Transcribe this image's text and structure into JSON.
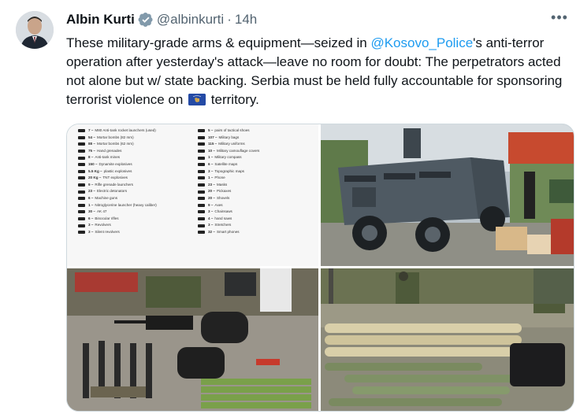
{
  "tweet": {
    "author_name": "Albin Kurti",
    "handle": "@albinkurti",
    "separator": "·",
    "time": "14h",
    "more_label": "•••",
    "text_1": "These military-grade arms & equipment—seized in ",
    "mention": "@Kosovo_Police",
    "text_2": "'s anti-terror operation after yesterday's attack—leave no room for doubt: The perpetrators acted not alone but w/ state backing. Serbia must be held fully accountable for sponsoring terrorist violence on ",
    "text_3": " territory."
  },
  "colors": {
    "link": "#1d9bf0",
    "text": "#0f1419",
    "muted": "#536471",
    "flag": "#244aa5"
  },
  "icons": [
    "verified-badge-icon",
    "more-options-icon",
    "kosovo-flag-emoji"
  ],
  "seized_list": {
    "left": [
      {
        "q": "7",
        "item": "M80 Anti-tank rocket launchers (used)"
      },
      {
        "q": "54",
        "item": "Mortar bombs (82 mm)"
      },
      {
        "q": "88",
        "item": "Mortar bombs (62 mm)"
      },
      {
        "q": "75",
        "item": "Hand grenades"
      },
      {
        "q": "8",
        "item": "Anti-tank mines"
      },
      {
        "q": "150",
        "item": "Dynamite explosives"
      },
      {
        "q": "5.5 Kg",
        "item": "plastic explosives"
      },
      {
        "q": "20 Kg",
        "item": "TNT explosives"
      },
      {
        "q": "9",
        "item": "Rifle grenade launchers"
      },
      {
        "q": "23",
        "item": "Electric detonators"
      },
      {
        "q": "6",
        "item": "Machine guns"
      },
      {
        "q": "1",
        "item": "Nitroglycerine launcher (heavy caliber)"
      },
      {
        "q": "30",
        "item": "AK 47"
      },
      {
        "q": "6",
        "item": "Binocular rifles"
      },
      {
        "q": "3",
        "item": "Revolvers"
      },
      {
        "q": "3",
        "item": "Silent revolvers"
      }
    ],
    "right": [
      {
        "q": "5",
        "item": "pairs of tactical shoes"
      },
      {
        "q": "107",
        "item": "Military bags"
      },
      {
        "q": "115",
        "item": "Military uniforms"
      },
      {
        "q": "10",
        "item": "Military camouflage covers"
      },
      {
        "q": "1",
        "item": "Military compass"
      },
      {
        "q": "6",
        "item": "Satellite maps"
      },
      {
        "q": "3",
        "item": "Topographic maps"
      },
      {
        "q": "1",
        "item": "Phone"
      },
      {
        "q": "23",
        "item": "Masks"
      },
      {
        "q": "20",
        "item": "Pickaxes"
      },
      {
        "q": "20",
        "item": "Shovels"
      },
      {
        "q": "9",
        "item": "Axes"
      },
      {
        "q": "3",
        "item": "Chainsaws"
      },
      {
        "q": "4",
        "item": "hand saws"
      },
      {
        "q": "3",
        "item": "Stretchers"
      },
      {
        "q": "32",
        "item": "Smart phones"
      }
    ]
  }
}
